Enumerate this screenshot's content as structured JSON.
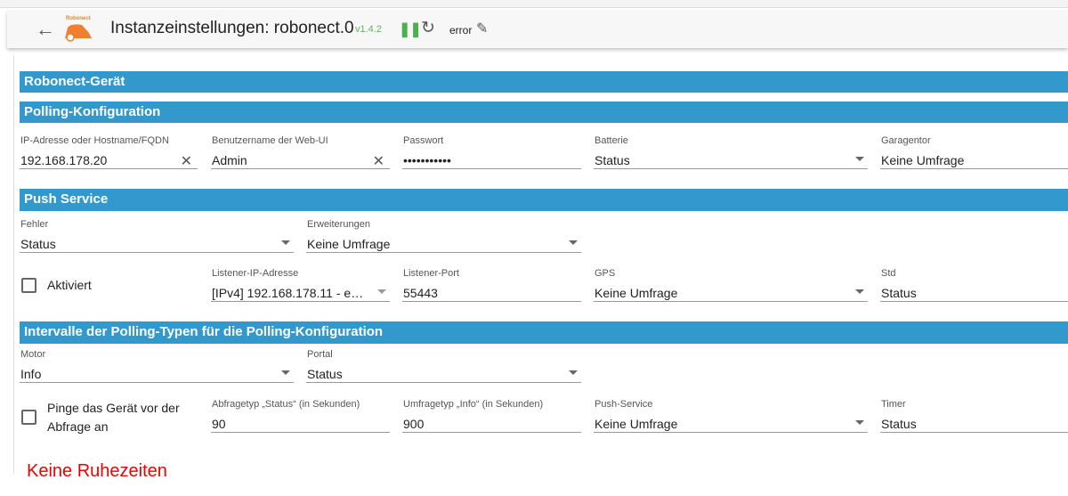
{
  "header": {
    "title": "Instanzeinstellungen: robonect.0",
    "logo_text": "Robonect",
    "version": "v1.4.2",
    "status": "error"
  },
  "sections": {
    "device": "Robonect-Gerät",
    "polling": "Polling-Konfiguration",
    "push": "Push Service",
    "intervals": "Intervalle der Polling-Typen für die Polling-Konfiguration"
  },
  "polling": {
    "ip": {
      "label": "IP-Adresse oder Hostname/FQDN",
      "value": "192.168.178.20"
    },
    "user": {
      "label": "Benutzername der Web-UI",
      "value": "Admin"
    },
    "password": {
      "label": "Passwort",
      "value": "•••••••••••"
    },
    "battery": {
      "label": "Batterie",
      "value": "Status"
    },
    "garage": {
      "label": "Garagentor",
      "value": "Keine Umfrage"
    }
  },
  "push": {
    "error": {
      "label": "Fehler",
      "value": "Status"
    },
    "ext": {
      "label": "Erweiterungen",
      "value": "Keine Umfrage"
    },
    "enabled": {
      "label": "Aktiviert",
      "checked": false
    },
    "listener_ip": {
      "label": "Listener-IP-Adresse",
      "value": "[IPv4] 192.168.178.11 - e…"
    },
    "listener_port": {
      "label": "Listener-Port",
      "value": "55443"
    },
    "gps": {
      "label": "GPS",
      "value": "Keine Umfrage"
    },
    "hour": {
      "label": "Std",
      "value": "Status"
    }
  },
  "intervals": {
    "motor": {
      "label": "Motor",
      "value": "Info"
    },
    "portal": {
      "label": "Portal",
      "value": "Status"
    },
    "ping": {
      "label": "Pinge das Gerät vor der Abfrage an",
      "checked": false
    },
    "status_interval": {
      "label": "Abfragetyp „Status“ (in Sekunden)",
      "value": "90"
    },
    "info_interval": {
      "label": "Umfragetyp „Info“ (in Sekunden)",
      "value": "900"
    },
    "push_service": {
      "label": "Push-Service",
      "value": "Keine Umfrage"
    },
    "timer": {
      "label": "Timer",
      "value": "Status"
    }
  },
  "note": "Keine Ruhezeiten"
}
